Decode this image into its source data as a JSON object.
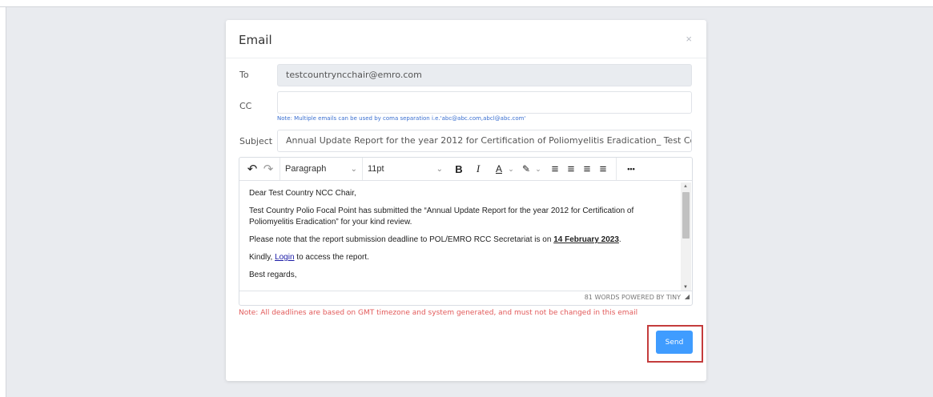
{
  "modal": {
    "title": "Email",
    "close_glyph": "×"
  },
  "form": {
    "to_label": "To",
    "to_value": "testcountryncchair@emro.com",
    "cc_label": "CC",
    "cc_value": "",
    "cc_hint": "Note: Multiple emails can be used by coma separation i.e.'abc@abc.com,abcl@abc.com'",
    "subject_label": "Subject",
    "subject_value": "Annual Update Report for the year 2012 for Certification of Poliomyelitis Eradication_ Test Country_ Sub"
  },
  "toolbar": {
    "undo_glyph": "↶",
    "redo_glyph": "↷",
    "block_format": "Paragraph",
    "font_size": "11pt",
    "chevron_glyph": "⌄",
    "bold_glyph": "B",
    "italic_glyph": "I",
    "font_color_glyph": "A",
    "highlight_glyph": "✎",
    "align_left_glyph": "≡",
    "align_center_glyph": "≡",
    "align_right_glyph": "≡",
    "justify_glyph": "≡",
    "more_glyph": "•••"
  },
  "editor": {
    "greeting": "Dear Test Country NCC Chair,",
    "para1": "Test Country Polio Focal Point has submitted the “Annual Update Report for the year 2012 for Certification of Poliomyelitis Eradication” for your kind review.",
    "para2_text": "Please note that the report submission deadline to POL/EMRO RCC Secretariat is on ",
    "para2_deadline": "14 February 2023",
    "para2_end": ".",
    "para3_pre": "Kindly, ",
    "para3_link": "Login",
    "para3_post": " to access the report.",
    "closing": "Best regards,",
    "status": "81 WORDS  POWERED BY TINY",
    "resize_glyph": "◢",
    "scroll_up_glyph": "▲",
    "scroll_down_glyph": "▼"
  },
  "note": "Note: All deadlines are based on GMT timezone and system generated, and must not be changed in this email",
  "send_label": "Send",
  "colors": {
    "accent": "#3f9cff",
    "note": "#e25a5a",
    "highlight_box": "#c43c3c"
  }
}
